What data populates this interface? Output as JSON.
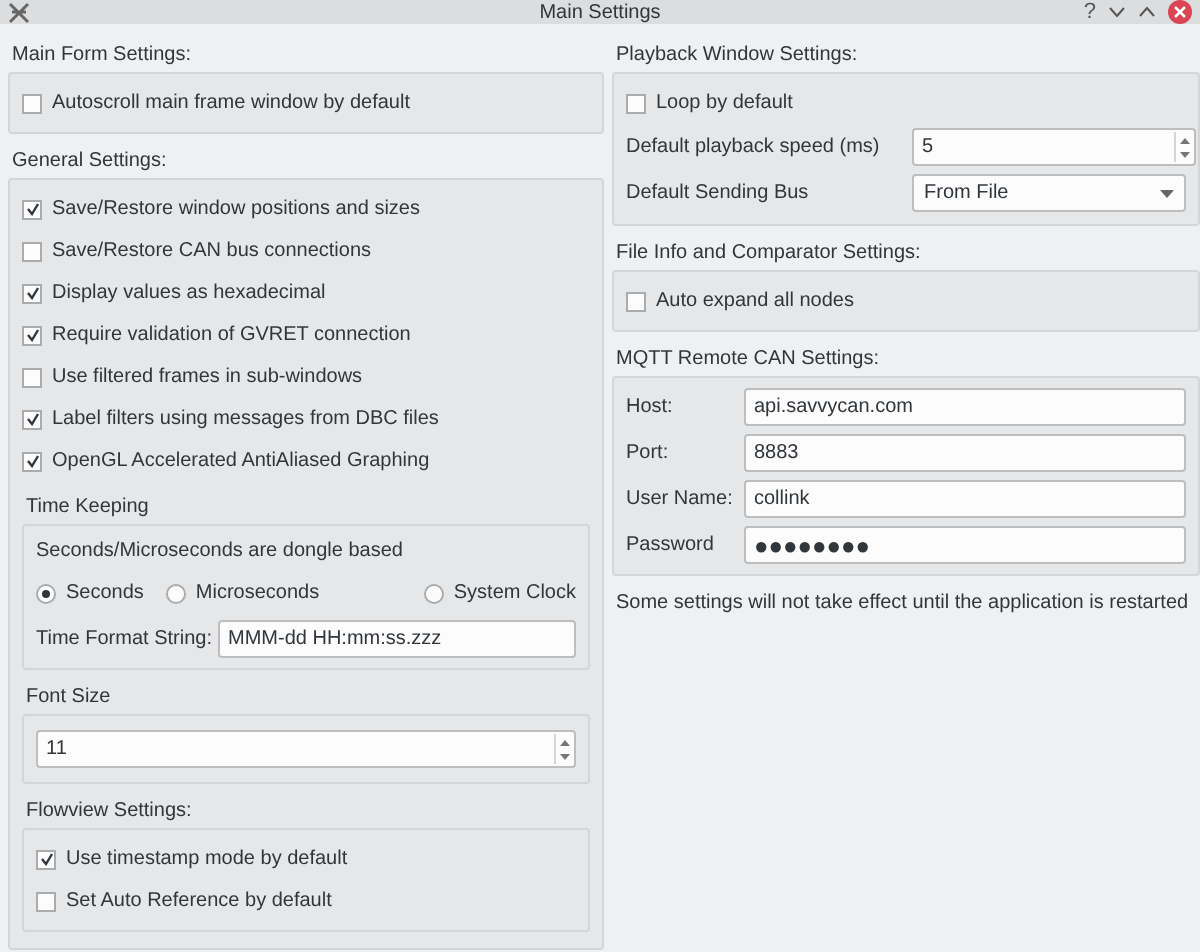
{
  "window": {
    "title": "Main Settings",
    "help": "?"
  },
  "main_form": {
    "heading": "Main Form Settings:",
    "checkboxes": [
      {
        "label": "Autoscroll main frame window by default",
        "checked": false
      }
    ]
  },
  "general": {
    "heading": "General Settings:",
    "checkboxes": [
      {
        "label": "Save/Restore window positions and sizes",
        "checked": true
      },
      {
        "label": "Save/Restore CAN bus connections",
        "checked": false
      },
      {
        "label": "Display values as hexadecimal",
        "checked": true
      },
      {
        "label": "Require validation of GVRET connection",
        "checked": true
      },
      {
        "label": "Use filtered frames in sub-windows",
        "checked": false
      },
      {
        "label": "Label filters using messages from DBC files",
        "checked": true
      },
      {
        "label": "OpenGL Accelerated AntiAliased Graphing",
        "checked": true
      }
    ],
    "time_keeping": {
      "heading": "Time Keeping",
      "note": "Seconds/Microseconds are dongle based",
      "radios": [
        {
          "label": "Seconds",
          "selected": true
        },
        {
          "label": "Microseconds",
          "selected": false
        },
        {
          "label": "System Clock",
          "selected": false
        }
      ],
      "format_label": "Time Format String:",
      "format_value": "MMM-dd HH:mm:ss.zzz"
    },
    "font_size": {
      "heading": "Font Size",
      "value": "11"
    },
    "flowview": {
      "heading": "Flowview Settings:",
      "checkboxes": [
        {
          "label": "Use timestamp mode by default",
          "checked": true
        },
        {
          "label": "Set Auto Reference by default",
          "checked": false
        }
      ]
    }
  },
  "playback": {
    "heading": "Playback Window Settings:",
    "loop": {
      "label": "Loop by default",
      "checked": false
    },
    "speed_label": "Default playback speed (ms)",
    "speed_value": "5",
    "bus_label": "Default Sending Bus",
    "bus_value": "From File"
  },
  "file_info": {
    "heading": "File Info and Comparator Settings:",
    "checkboxes": [
      {
        "label": "Auto expand all nodes",
        "checked": false
      }
    ]
  },
  "mqtt": {
    "heading": "MQTT Remote CAN Settings:",
    "fields": [
      {
        "label": "Host:",
        "value": "api.savvycan.com"
      },
      {
        "label": "Port:",
        "value": "8883"
      },
      {
        "label": "User Name:",
        "value": "collink"
      },
      {
        "label": "Password",
        "value": "●●●●●●●●"
      }
    ]
  },
  "note": "Some settings will not take effect until the application is restarted"
}
